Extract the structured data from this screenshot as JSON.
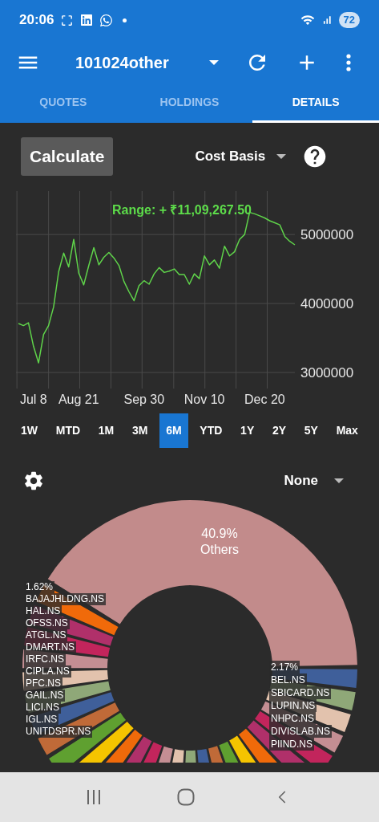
{
  "status_bar": {
    "time": "20:06",
    "battery": "72"
  },
  "app_bar": {
    "title": "101024other"
  },
  "tabs": [
    {
      "label": "QUOTES",
      "selected": false
    },
    {
      "label": "HOLDINGS",
      "selected": false
    },
    {
      "label": "DETAILS",
      "selected": true
    }
  ],
  "controls": {
    "calculate_button": "Calculate",
    "basis": "Cost Basis"
  },
  "chart": {
    "range_label": "Range: + ₹11,09,267.50",
    "chart_data": {
      "type": "line",
      "grid": true,
      "ylim": [
        3000000,
        5630000
      ],
      "yticks": [
        3000000,
        4000000,
        5000000
      ],
      "categories": [
        null,
        null,
        null,
        "Jul 8",
        null,
        null,
        null,
        null,
        null,
        null,
        null,
        null,
        "Aug 21",
        null,
        null,
        null,
        null,
        null,
        null,
        null,
        null,
        null,
        null,
        null,
        null,
        "Sep 30",
        null,
        null,
        null,
        null,
        null,
        null,
        null,
        null,
        null,
        null,
        null,
        "Nov 10",
        null,
        null,
        null,
        null,
        null,
        null,
        null,
        null,
        null,
        null,
        null,
        "Dec 20",
        null,
        null,
        null,
        null,
        null,
        null
      ],
      "series": [
        {
          "color": "#5fd34a",
          "values": [
            3710000,
            3680000,
            3720000,
            3380000,
            3140000,
            3550000,
            3680000,
            3950000,
            4460000,
            4730000,
            4530000,
            4930000,
            4440000,
            4270000,
            4550000,
            4810000,
            4560000,
            4670000,
            4740000,
            4660000,
            4550000,
            4320000,
            4170000,
            4040000,
            4260000,
            4330000,
            4280000,
            4430000,
            4520000,
            4450000,
            4470000,
            4500000,
            4420000,
            4420000,
            4280000,
            4430000,
            4360000,
            4690000,
            4560000,
            4630000,
            4510000,
            4830000,
            4690000,
            4750000,
            4930000,
            5000000,
            5320000,
            5300000,
            5270000,
            5240000,
            5200000,
            5170000,
            5140000,
            4970000,
            4900000,
            4850000
          ]
        }
      ]
    }
  },
  "periods": [
    {
      "label": "1W",
      "selected": false
    },
    {
      "label": "MTD",
      "selected": false
    },
    {
      "label": "1M",
      "selected": false
    },
    {
      "label": "3M",
      "selected": false
    },
    {
      "label": "6M",
      "selected": true
    },
    {
      "label": "YTD",
      "selected": false
    },
    {
      "label": "1Y",
      "selected": false
    },
    {
      "label": "2Y",
      "selected": false
    },
    {
      "label": "5Y",
      "selected": false
    },
    {
      "label": "Max",
      "selected": false
    }
  ],
  "grouping": {
    "value": "None"
  },
  "donut": {
    "main_slice": {
      "percent": "40.9%",
      "label": "Others"
    },
    "left_labels": [
      "1.62%",
      "BAJAJHLDNG.NS",
      "HAL.NS",
      "OFSS.NS",
      "ATGL.NS",
      "DMART.NS",
      "IRFC.NS",
      "CIPLA.NS",
      "PFC.NS",
      "GAIL.NS",
      "LICI.NS",
      "IGL.NS",
      "UNITDSPR.NS"
    ],
    "right_labels": [
      "2.17%",
      "BEL.NS",
      "SBICARD.NS",
      "LUPIN.NS",
      "NHPC.NS",
      "DIVISLAB.NS",
      "PIIND.NS"
    ]
  }
}
